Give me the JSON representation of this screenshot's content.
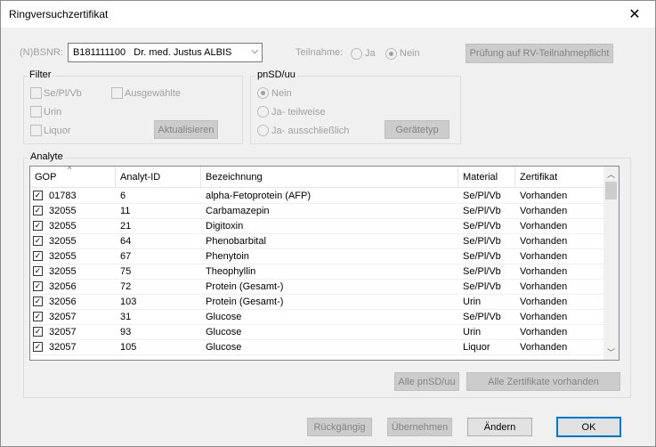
{
  "window": {
    "title": "Ringversuchzertifikat",
    "close_icon": "close-icon"
  },
  "bsnr": {
    "label": "(N)BSNR:",
    "value": "B181111100   Dr. med. Justus ALBIS"
  },
  "teilnahme": {
    "label": "Teilnahme:",
    "option_ja": "Ja",
    "option_nein": "Nein",
    "selected": "Nein"
  },
  "pruefung_button": "Prüfung auf RV-Teilnahmepflicht",
  "filter": {
    "title": "Filter",
    "se_pl_vb": "Se/Pl/Vb",
    "urin": "Urin",
    "liquor": "Liquor",
    "ausgewaehlte": "Ausgewählte",
    "aktualisieren": "Aktualisieren"
  },
  "pnsd": {
    "title": "pnSD/uu",
    "nein": "Nein",
    "teilweise": "Ja- teilweise",
    "ausschliesslich": "Ja- ausschließlich",
    "selected": "Nein",
    "geraetetyp": "Gerätetyp"
  },
  "analyte": {
    "title": "Analyte",
    "columns": [
      "GOP",
      "Analyt-ID",
      "Bezeichnung",
      "Material",
      "Zertifikat"
    ],
    "rows": [
      {
        "checked": true,
        "gop": "01783",
        "id": "6",
        "bez": "alpha-Fetoprotein (AFP)",
        "material": "Se/Pl/Vb",
        "zert": "Vorhanden"
      },
      {
        "checked": true,
        "gop": "32055",
        "id": "11",
        "bez": "Carbamazepin",
        "material": "Se/Pl/Vb",
        "zert": "Vorhanden"
      },
      {
        "checked": true,
        "gop": "32055",
        "id": "21",
        "bez": "Digitoxin",
        "material": "Se/Pl/Vb",
        "zert": "Vorhanden"
      },
      {
        "checked": true,
        "gop": "32055",
        "id": "64",
        "bez": "Phenobarbital",
        "material": "Se/Pl/Vb",
        "zert": "Vorhanden"
      },
      {
        "checked": true,
        "gop": "32055",
        "id": "67",
        "bez": "Phenytoin",
        "material": "Se/Pl/Vb",
        "zert": "Vorhanden"
      },
      {
        "checked": true,
        "gop": "32055",
        "id": "75",
        "bez": "Theophyllin",
        "material": "Se/Pl/Vb",
        "zert": "Vorhanden"
      },
      {
        "checked": true,
        "gop": "32056",
        "id": "72",
        "bez": "Protein (Gesamt-)",
        "material": "Se/Pl/Vb",
        "zert": "Vorhanden"
      },
      {
        "checked": true,
        "gop": "32056",
        "id": "103",
        "bez": "Protein (Gesamt-)",
        "material": "Urin",
        "zert": "Vorhanden"
      },
      {
        "checked": true,
        "gop": "32057",
        "id": "31",
        "bez": "Glucose",
        "material": "Se/Pl/Vb",
        "zert": "Vorhanden"
      },
      {
        "checked": true,
        "gop": "32057",
        "id": "93",
        "bez": "Glucose",
        "material": "Urin",
        "zert": "Vorhanden"
      },
      {
        "checked": true,
        "gop": "32057",
        "id": "105",
        "bez": "Glucose",
        "material": "Liquor",
        "zert": "Vorhanden"
      }
    ],
    "alle_pnsd": "Alle pnSD/uu",
    "alle_zertifikate": "Alle Zertifikate vorhanden"
  },
  "footer": {
    "rueckgaengig": "Rückgängig",
    "uebernehmen": "Übernehmen",
    "aendern": "Ändern",
    "ok": "OK"
  }
}
